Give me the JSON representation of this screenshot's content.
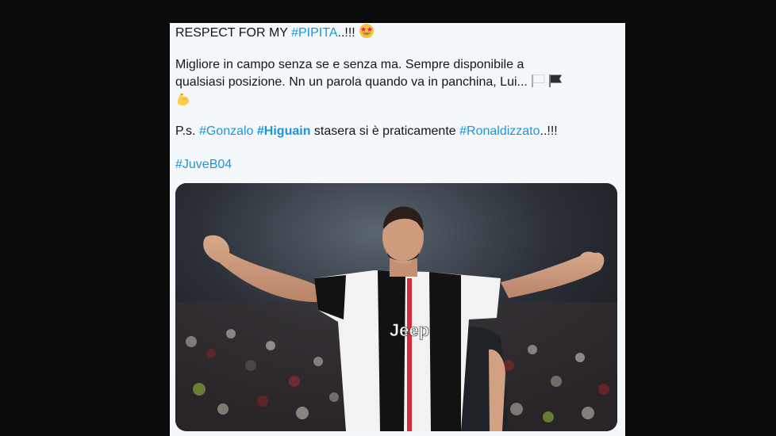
{
  "tweet": {
    "line1_prefix": "RESPECT FOR MY ",
    "line1_tag": "#PIPITA",
    "line1_suffix": "..!!! ",
    "line2": "Migliore in campo senza se e senza ma. Sempre disponibile a",
    "line3": "qualsiasi posizione. Nn un parola quando va in panchina, Lui... ",
    "ps_prefix": "P.s. ",
    "ps_tag1": "#Gonzalo",
    "ps_space1": " ",
    "ps_tag2": "#Higuain",
    "ps_middle": " stasera si è praticamente ",
    "ps_tag3": "#Ronaldizzato",
    "ps_suffix": "..!!!",
    "final_tag": "#JuveB04"
  },
  "icons": {
    "star_struck": "star-struck-emoji",
    "white_flag": "white-flag-emoji",
    "black_flag": "black-flag-emoji",
    "flexed_biceps": "flexed-biceps-emoji"
  },
  "media": {
    "jersey_sponsor": "Jeep"
  },
  "colors": {
    "hashtag": "#1b95e0",
    "text": "#14171a",
    "card_bg": "#f5f8fa",
    "page_bg": "#0b0b0b"
  }
}
